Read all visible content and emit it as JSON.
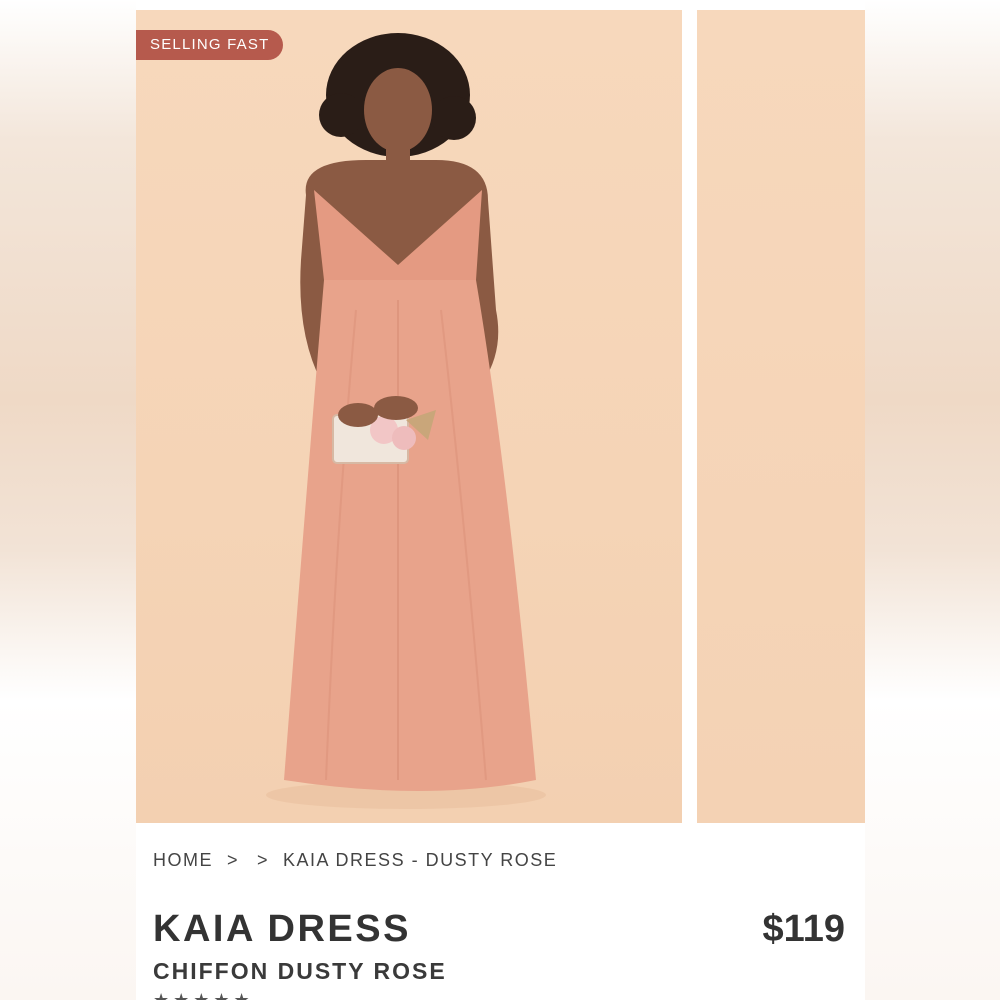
{
  "badge": {
    "label": "SELLING FAST"
  },
  "breadcrumb": {
    "home": "HOME",
    "separator": ">",
    "current": "KAIA DRESS - DUSTY ROSE"
  },
  "product": {
    "name": "KAIA DRESS",
    "variant": "CHIFFON DUSTY ROSE",
    "price": "$119",
    "rating_stars": "★★★★★"
  },
  "colors": {
    "badge": "#b65a4d",
    "backdrop": "#f5d4b6",
    "dress": "#e49a82",
    "text": "#333333"
  },
  "icons": {
    "breadcrumb_separator": "chevron-right-icon"
  }
}
